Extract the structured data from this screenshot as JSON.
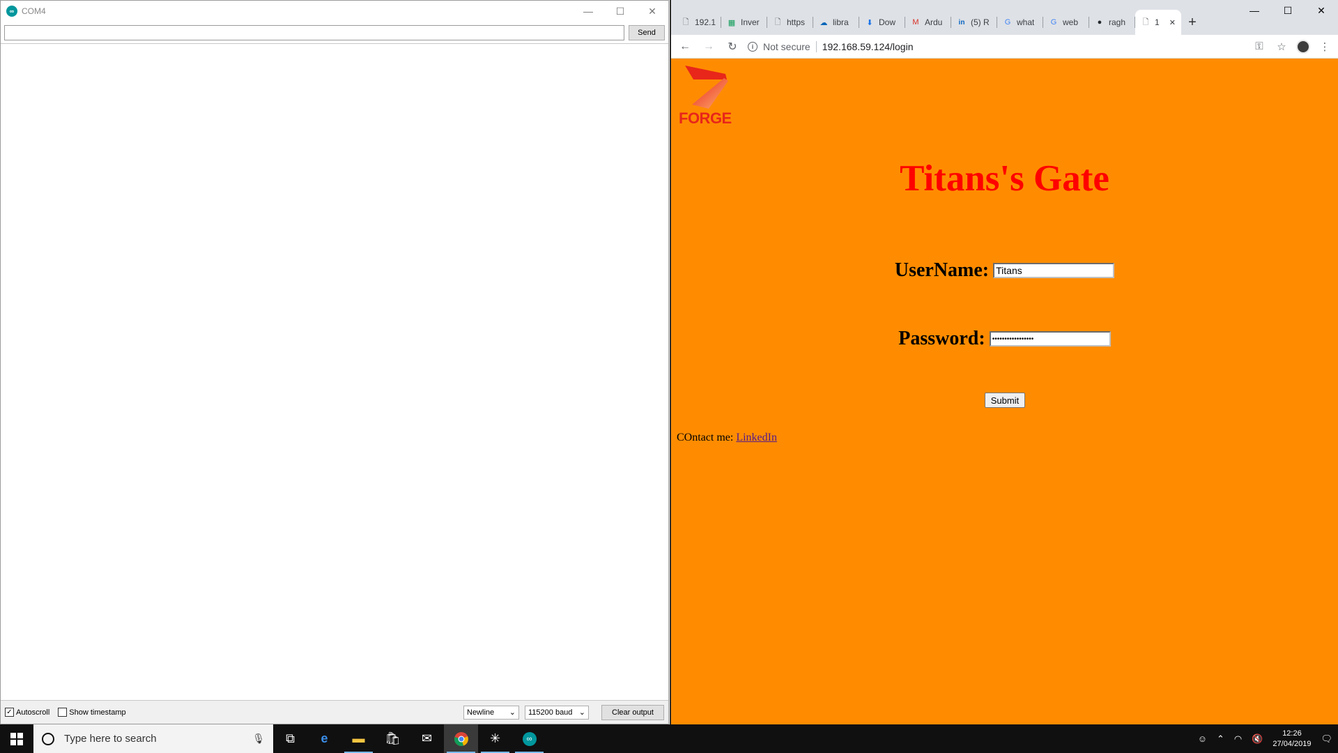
{
  "serial_monitor": {
    "title": "COM4",
    "send_label": "Send",
    "command_value": "",
    "autoscroll_label": "Autoscroll",
    "autoscroll_checked": true,
    "timestamp_label": "Show timestamp",
    "timestamp_checked": false,
    "line_ending": "Newline",
    "baud_rate": "115200 baud",
    "clear_label": "Clear output"
  },
  "browser": {
    "tabs": [
      {
        "title": "192.1",
        "icon": "page-icon"
      },
      {
        "title": "Inver",
        "icon": "sheets-icon"
      },
      {
        "title": "https",
        "icon": "page-icon"
      },
      {
        "title": "libra",
        "icon": "onedrive-icon"
      },
      {
        "title": "Dow",
        "icon": "download-icon"
      },
      {
        "title": "Ardu",
        "icon": "gmail-icon"
      },
      {
        "title": "(5) R",
        "icon": "linkedin-icon"
      },
      {
        "title": "what",
        "icon": "google-icon"
      },
      {
        "title": "web",
        "icon": "google-icon"
      },
      {
        "title": "ragh",
        "icon": "github-icon"
      },
      {
        "title": "1",
        "icon": "page-icon",
        "active": true
      }
    ],
    "security_label": "Not secure",
    "url": "192.168.59.124/login"
  },
  "page": {
    "logo_text": "FORGE",
    "heading": "Titans's Gate",
    "username_label": "UserName:",
    "username_value": "Titans",
    "password_label": "Password:",
    "password_value": "•••••••••••••••••",
    "submit_label": "Submit",
    "contact_label": "COntact me:",
    "contact_link": "LinkedIn",
    "heading_color": "#ff0000",
    "background_color": "#ff8c00"
  },
  "taskbar": {
    "search_placeholder": "Type here to search",
    "time": "12:26",
    "date": "27/04/2019"
  }
}
